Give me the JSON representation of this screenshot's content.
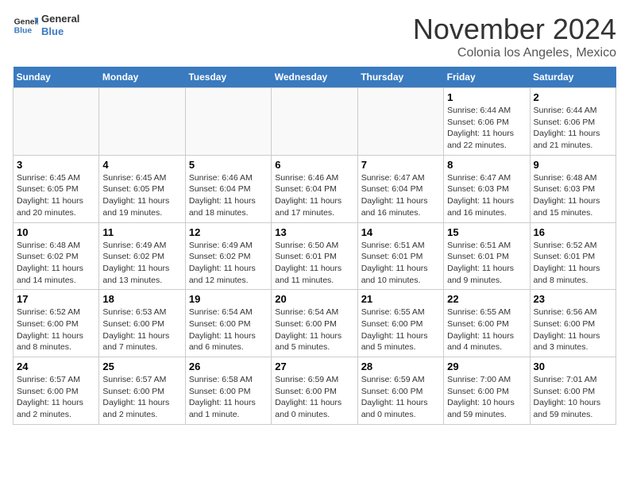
{
  "header": {
    "logo_line1": "General",
    "logo_line2": "Blue",
    "month": "November 2024",
    "location": "Colonia los Angeles, Mexico"
  },
  "weekdays": [
    "Sunday",
    "Monday",
    "Tuesday",
    "Wednesday",
    "Thursday",
    "Friday",
    "Saturday"
  ],
  "weeks": [
    [
      {
        "day": "",
        "info": ""
      },
      {
        "day": "",
        "info": ""
      },
      {
        "day": "",
        "info": ""
      },
      {
        "day": "",
        "info": ""
      },
      {
        "day": "",
        "info": ""
      },
      {
        "day": "1",
        "info": "Sunrise: 6:44 AM\nSunset: 6:06 PM\nDaylight: 11 hours\nand 22 minutes."
      },
      {
        "day": "2",
        "info": "Sunrise: 6:44 AM\nSunset: 6:06 PM\nDaylight: 11 hours\nand 21 minutes."
      }
    ],
    [
      {
        "day": "3",
        "info": "Sunrise: 6:45 AM\nSunset: 6:05 PM\nDaylight: 11 hours\nand 20 minutes."
      },
      {
        "day": "4",
        "info": "Sunrise: 6:45 AM\nSunset: 6:05 PM\nDaylight: 11 hours\nand 19 minutes."
      },
      {
        "day": "5",
        "info": "Sunrise: 6:46 AM\nSunset: 6:04 PM\nDaylight: 11 hours\nand 18 minutes."
      },
      {
        "day": "6",
        "info": "Sunrise: 6:46 AM\nSunset: 6:04 PM\nDaylight: 11 hours\nand 17 minutes."
      },
      {
        "day": "7",
        "info": "Sunrise: 6:47 AM\nSunset: 6:04 PM\nDaylight: 11 hours\nand 16 minutes."
      },
      {
        "day": "8",
        "info": "Sunrise: 6:47 AM\nSunset: 6:03 PM\nDaylight: 11 hours\nand 16 minutes."
      },
      {
        "day": "9",
        "info": "Sunrise: 6:48 AM\nSunset: 6:03 PM\nDaylight: 11 hours\nand 15 minutes."
      }
    ],
    [
      {
        "day": "10",
        "info": "Sunrise: 6:48 AM\nSunset: 6:02 PM\nDaylight: 11 hours\nand 14 minutes."
      },
      {
        "day": "11",
        "info": "Sunrise: 6:49 AM\nSunset: 6:02 PM\nDaylight: 11 hours\nand 13 minutes."
      },
      {
        "day": "12",
        "info": "Sunrise: 6:49 AM\nSunset: 6:02 PM\nDaylight: 11 hours\nand 12 minutes."
      },
      {
        "day": "13",
        "info": "Sunrise: 6:50 AM\nSunset: 6:01 PM\nDaylight: 11 hours\nand 11 minutes."
      },
      {
        "day": "14",
        "info": "Sunrise: 6:51 AM\nSunset: 6:01 PM\nDaylight: 11 hours\nand 10 minutes."
      },
      {
        "day": "15",
        "info": "Sunrise: 6:51 AM\nSunset: 6:01 PM\nDaylight: 11 hours\nand 9 minutes."
      },
      {
        "day": "16",
        "info": "Sunrise: 6:52 AM\nSunset: 6:01 PM\nDaylight: 11 hours\nand 8 minutes."
      }
    ],
    [
      {
        "day": "17",
        "info": "Sunrise: 6:52 AM\nSunset: 6:00 PM\nDaylight: 11 hours\nand 8 minutes."
      },
      {
        "day": "18",
        "info": "Sunrise: 6:53 AM\nSunset: 6:00 PM\nDaylight: 11 hours\nand 7 minutes."
      },
      {
        "day": "19",
        "info": "Sunrise: 6:54 AM\nSunset: 6:00 PM\nDaylight: 11 hours\nand 6 minutes."
      },
      {
        "day": "20",
        "info": "Sunrise: 6:54 AM\nSunset: 6:00 PM\nDaylight: 11 hours\nand 5 minutes."
      },
      {
        "day": "21",
        "info": "Sunrise: 6:55 AM\nSunset: 6:00 PM\nDaylight: 11 hours\nand 5 minutes."
      },
      {
        "day": "22",
        "info": "Sunrise: 6:55 AM\nSunset: 6:00 PM\nDaylight: 11 hours\nand 4 minutes."
      },
      {
        "day": "23",
        "info": "Sunrise: 6:56 AM\nSunset: 6:00 PM\nDaylight: 11 hours\nand 3 minutes."
      }
    ],
    [
      {
        "day": "24",
        "info": "Sunrise: 6:57 AM\nSunset: 6:00 PM\nDaylight: 11 hours\nand 2 minutes."
      },
      {
        "day": "25",
        "info": "Sunrise: 6:57 AM\nSunset: 6:00 PM\nDaylight: 11 hours\nand 2 minutes."
      },
      {
        "day": "26",
        "info": "Sunrise: 6:58 AM\nSunset: 6:00 PM\nDaylight: 11 hours\nand 1 minute."
      },
      {
        "day": "27",
        "info": "Sunrise: 6:59 AM\nSunset: 6:00 PM\nDaylight: 11 hours\nand 0 minutes."
      },
      {
        "day": "28",
        "info": "Sunrise: 6:59 AM\nSunset: 6:00 PM\nDaylight: 11 hours\nand 0 minutes."
      },
      {
        "day": "29",
        "info": "Sunrise: 7:00 AM\nSunset: 6:00 PM\nDaylight: 10 hours\nand 59 minutes."
      },
      {
        "day": "30",
        "info": "Sunrise: 7:01 AM\nSunset: 6:00 PM\nDaylight: 10 hours\nand 59 minutes."
      }
    ]
  ]
}
